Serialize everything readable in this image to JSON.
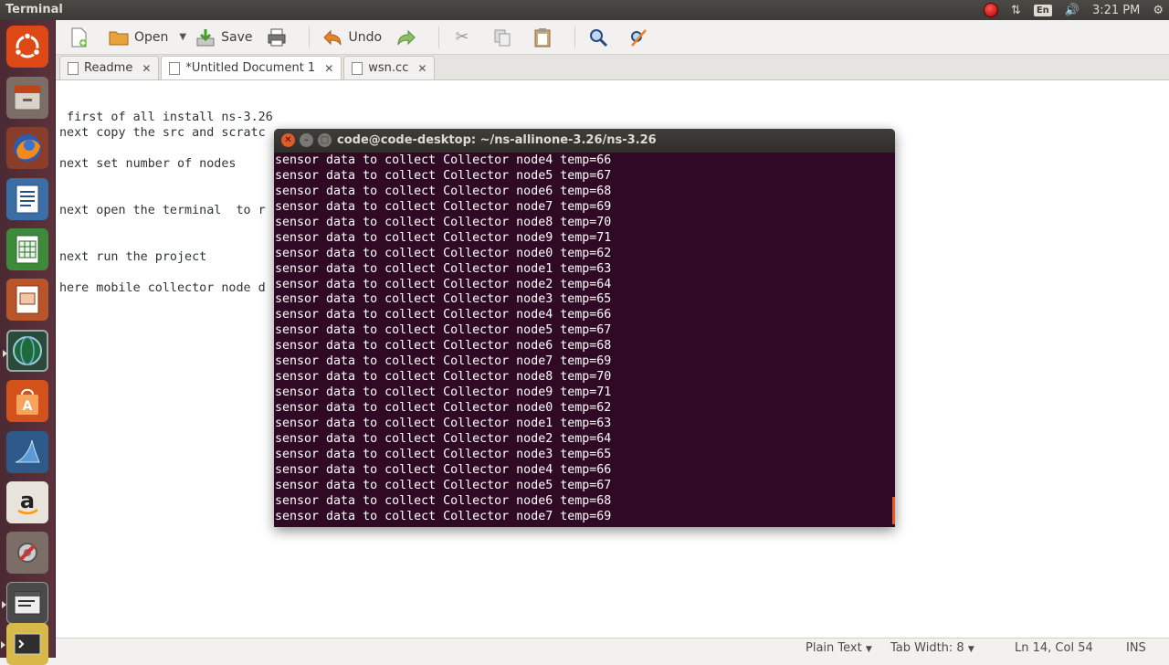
{
  "top_panel": {
    "app_title": "Terminal",
    "lang": "En",
    "clock": "3:21 PM"
  },
  "launcher": {
    "items": [
      {
        "name": "dash-home"
      },
      {
        "name": "files"
      },
      {
        "name": "firefox"
      },
      {
        "name": "libreoffice-writer"
      },
      {
        "name": "libreoffice-calc"
      },
      {
        "name": "libreoffice-impress"
      },
      {
        "name": "wireshark"
      },
      {
        "name": "software-center"
      },
      {
        "name": "wireshark-shark"
      },
      {
        "name": "amazon"
      },
      {
        "name": "system-settings"
      },
      {
        "name": "text-editor"
      },
      {
        "name": "terminal"
      }
    ]
  },
  "gedit": {
    "toolbar": {
      "open_label": "Open",
      "save_label": "Save",
      "undo_label": "Undo"
    },
    "tabs": [
      {
        "label": "Readme"
      },
      {
        "label": "*Untitled Document 1"
      },
      {
        "label": "wsn.cc"
      }
    ],
    "editor_lines": [
      " first of all install ns-3.26",
      "next copy the src and scratc",
      "",
      "next set number of nodes",
      "",
      "",
      "next open the terminal  to r",
      "",
      "",
      "next run the project",
      "",
      "here mobile collector node d"
    ],
    "status": {
      "language": "Plain Text",
      "tab_width": "Tab Width: 8",
      "position": "Ln 14, Col 54",
      "mode": "INS"
    }
  },
  "terminal": {
    "title": "code@code-desktop: ~/ns-allinone-3.26/ns-3.26",
    "lines": [
      "sensor data to collect Collector node4 temp=66",
      "sensor data to collect Collector node5 temp=67",
      "sensor data to collect Collector node6 temp=68",
      "sensor data to collect Collector node7 temp=69",
      "sensor data to collect Collector node8 temp=70",
      "sensor data to collect Collector node9 temp=71",
      "sensor data to collect Collector node0 temp=62",
      "sensor data to collect Collector node1 temp=63",
      "sensor data to collect Collector node2 temp=64",
      "sensor data to collect Collector node3 temp=65",
      "sensor data to collect Collector node4 temp=66",
      "sensor data to collect Collector node5 temp=67",
      "sensor data to collect Collector node6 temp=68",
      "sensor data to collect Collector node7 temp=69",
      "sensor data to collect Collector node8 temp=70",
      "sensor data to collect Collector node9 temp=71",
      "sensor data to collect Collector node0 temp=62",
      "sensor data to collect Collector node1 temp=63",
      "sensor data to collect Collector node2 temp=64",
      "sensor data to collect Collector node3 temp=65",
      "sensor data to collect Collector node4 temp=66",
      "sensor data to collect Collector node5 temp=67",
      "sensor data to collect Collector node6 temp=68",
      "sensor data to collect Collector node7 temp=69"
    ]
  },
  "colors": {
    "terminal_bg": "#300a24",
    "launcher_bg": "#5c323c",
    "panel_bg": "#3c3b37"
  }
}
